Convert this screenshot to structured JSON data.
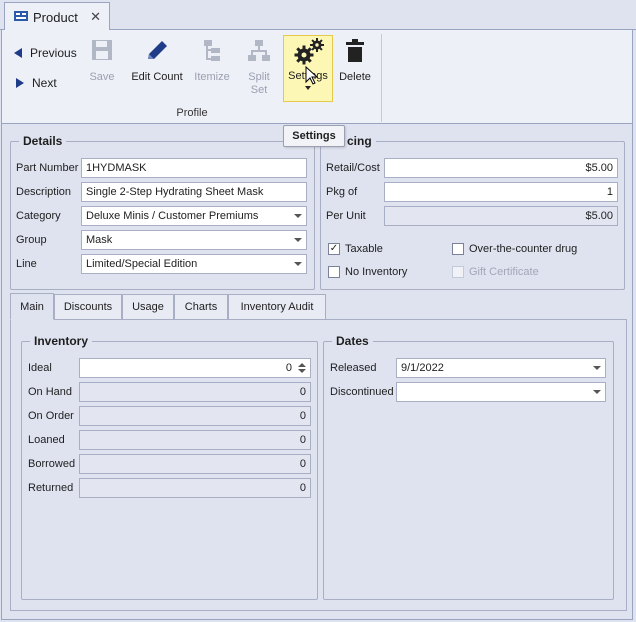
{
  "document_tab": {
    "title": "Product",
    "close": "✕"
  },
  "ribbon": {
    "previous": "Previous",
    "next": "Next",
    "save": "Save",
    "edit_count": "Edit Count",
    "itemize": "Itemize",
    "split_set_1": "Split",
    "split_set_2": "Set",
    "settings": "Settings",
    "delete": "Delete",
    "group_label": "Profile"
  },
  "tooltip": "Settings",
  "details": {
    "legend": "Details",
    "fields": [
      {
        "label": "Part Number",
        "value": "1HYDMASK"
      },
      {
        "label": "Description",
        "value": "Single 2-Step Hydrating Sheet Mask"
      },
      {
        "label": "Category",
        "value": "Deluxe Minis / Customer Premiums"
      },
      {
        "label": "Group",
        "value": "Mask"
      },
      {
        "label": "Line",
        "value": "Limited/Special Edition"
      }
    ]
  },
  "pricing": {
    "legend": "cing",
    "fields": [
      {
        "label": "Retail/Cost",
        "value": "$5.00"
      },
      {
        "label": "Pkg of",
        "value": "1"
      },
      {
        "label": "Per Unit",
        "value": "$5.00"
      }
    ],
    "checkboxes": [
      {
        "label": "Taxable",
        "checked": "✓"
      },
      {
        "label": "Over-the-counter drug",
        "checked": ""
      },
      {
        "label": "No Inventory",
        "checked": ""
      },
      {
        "label": "Gift Certificate",
        "checked": ""
      }
    ]
  },
  "tabs": [
    "Main",
    "Discounts",
    "Usage",
    "Charts",
    "Inventory Audit"
  ],
  "inventory": {
    "legend": "Inventory",
    "fields": [
      {
        "label": "Ideal",
        "value": "0"
      },
      {
        "label": "On Hand",
        "value": "0"
      },
      {
        "label": "On Order",
        "value": "0"
      },
      {
        "label": "Loaned",
        "value": "0"
      },
      {
        "label": "Borrowed",
        "value": "0"
      },
      {
        "label": "Returned",
        "value": "0"
      }
    ]
  },
  "dates": {
    "legend": "Dates",
    "fields": [
      {
        "label": "Released",
        "value": "9/1/2022"
      },
      {
        "label": "Discontinued",
        "value": ""
      }
    ]
  },
  "colors": {
    "accent": "#1e3c87",
    "highlight": "#fdf7b6",
    "background": "#dfe3f0"
  }
}
